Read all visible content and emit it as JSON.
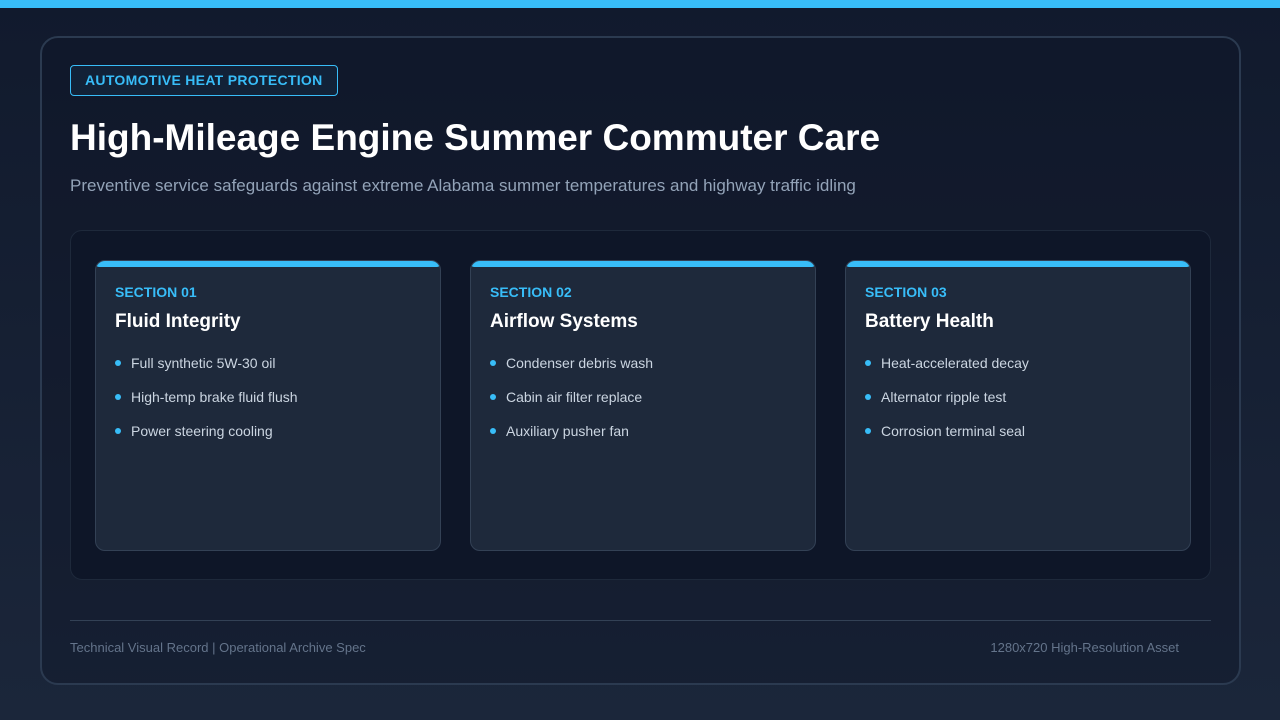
{
  "colors": {
    "accent": "#38bdf8",
    "background": "#111a2d",
    "card": "#1e293b",
    "heading": "#ffffff",
    "muted": "#93a3b8"
  },
  "header": {
    "tag": "AUTOMOTIVE HEAT PROTECTION",
    "title": "High-Mileage Engine Summer Commuter Care",
    "subtitle": "Preventive service safeguards against extreme Alabama summer temperatures and highway traffic idling"
  },
  "cards": [
    {
      "section": "SECTION 01",
      "title": "Fluid Integrity",
      "items": [
        "Full synthetic 5W-30 oil",
        "High-temp brake fluid flush",
        "Power steering cooling"
      ]
    },
    {
      "section": "SECTION 02",
      "title": "Airflow Systems",
      "items": [
        "Condenser debris wash",
        "Cabin air filter replace",
        "Auxiliary pusher fan"
      ]
    },
    {
      "section": "SECTION 03",
      "title": "Battery Health",
      "items": [
        "Heat-accelerated decay",
        "Alternator ripple test",
        "Corrosion terminal seal"
      ]
    }
  ],
  "footer": {
    "left": "Technical Visual Record | Operational Archive Spec",
    "right": "1280x720 High-Resolution Asset"
  }
}
